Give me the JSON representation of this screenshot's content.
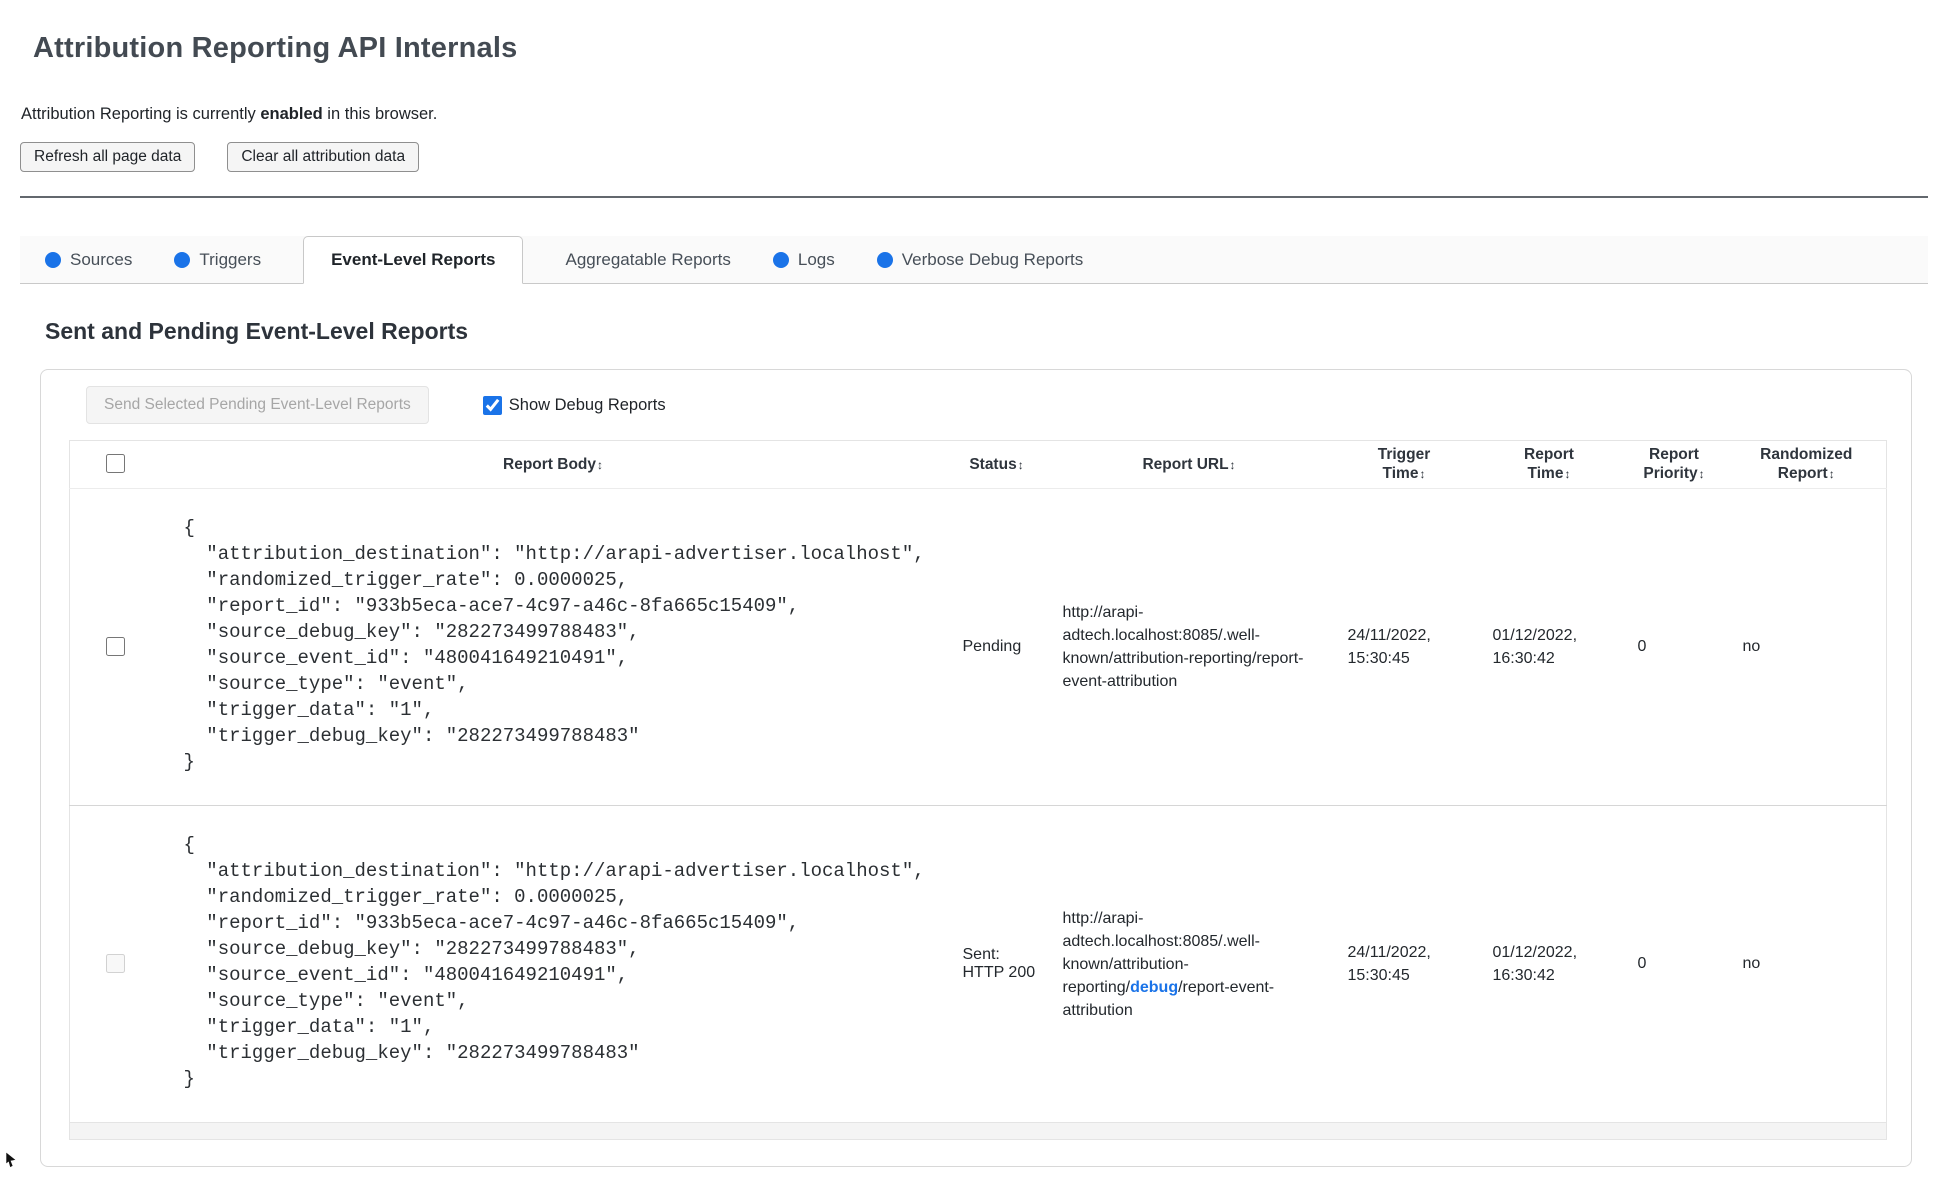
{
  "header": {
    "title": "Attribution Reporting API Internals"
  },
  "status_line": {
    "prefix": "Attribution Reporting is currently ",
    "emphasis": "enabled",
    "suffix": " in this browser."
  },
  "toolbar": {
    "refresh_label": "Refresh all page data",
    "clear_label": "Clear all attribution data"
  },
  "tabs": {
    "items": [
      {
        "label": "Sources",
        "has_dot": true,
        "active": false
      },
      {
        "label": "Triggers",
        "has_dot": true,
        "active": false
      },
      {
        "label": "Event-Level Reports",
        "has_dot": false,
        "active": true
      },
      {
        "label": "Aggregatable Reports",
        "has_dot": false,
        "active": false
      },
      {
        "label": "Logs",
        "has_dot": true,
        "active": false
      },
      {
        "label": "Verbose Debug Reports",
        "has_dot": true,
        "active": false
      }
    ]
  },
  "section": {
    "title": "Sent and Pending Event-Level Reports"
  },
  "panel": {
    "send_button_label": "Send Selected Pending Event-Level Reports",
    "send_button_enabled": false,
    "show_debug_label": "Show Debug Reports",
    "show_debug_checked": true
  },
  "table": {
    "sort_icon": "↕",
    "select_all_checked": false,
    "columns": [
      "Report Body",
      "Status",
      "Report URL",
      "Trigger Time",
      "Report Time",
      "Report Priority",
      "Randomized Report"
    ]
  },
  "reports": [
    {
      "selected": false,
      "selectable": true,
      "body": "{\n  \"attribution_destination\": \"http://arapi-advertiser.localhost\",\n  \"randomized_trigger_rate\": 0.0000025,\n  \"report_id\": \"933b5eca-ace7-4c97-a46c-8fa665c15409\",\n  \"source_debug_key\": \"282273499788483\",\n  \"source_event_id\": \"480041649210491\",\n  \"source_type\": \"event\",\n  \"trigger_data\": \"1\",\n  \"trigger_debug_key\": \"282273499788483\"\n}",
      "status": "Pending",
      "report_url_prefix": "http://arapi-adtech.localhost:8085/.well-known/attribution-reporting/report-event-attribution",
      "report_url_debug": "",
      "report_url_suffix": "",
      "trigger_time": "24/11/2022, 15:30:45",
      "report_time": "01/12/2022, 16:30:42",
      "report_priority": "0",
      "randomized_report": "no"
    },
    {
      "selected": false,
      "selectable": false,
      "body": "{\n  \"attribution_destination\": \"http://arapi-advertiser.localhost\",\n  \"randomized_trigger_rate\": 0.0000025,\n  \"report_id\": \"933b5eca-ace7-4c97-a46c-8fa665c15409\",\n  \"source_debug_key\": \"282273499788483\",\n  \"source_event_id\": \"480041649210491\",\n  \"source_type\": \"event\",\n  \"trigger_data\": \"1\",\n  \"trigger_debug_key\": \"282273499788483\"\n}",
      "status": "Sent: HTTP 200",
      "report_url_prefix": "http://arapi-adtech.localhost:8085/.well-known/attribution-reporting/",
      "report_url_debug": "debug",
      "report_url_suffix": "/report-event-attribution",
      "trigger_time": "24/11/2022, 15:30:45",
      "report_time": "01/12/2022, 16:30:42",
      "report_priority": "0",
      "randomized_report": "no"
    }
  ],
  "colors": {
    "accent_blue": "#1a73e8",
    "dot_blue": "#1a73e8",
    "debug_link_blue": "#1a73e8"
  }
}
